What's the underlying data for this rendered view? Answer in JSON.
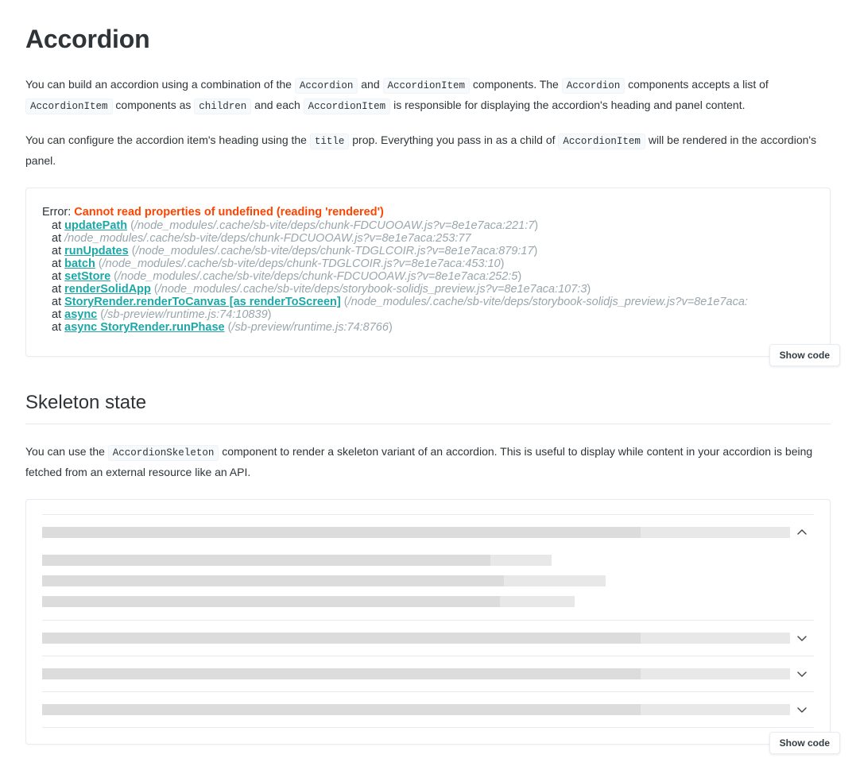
{
  "page": {
    "title": "Accordion"
  },
  "intro": {
    "p1": {
      "t1": "You can build an accordion using a combination of the ",
      "c1": "Accordion",
      "t2": " and ",
      "c2": "AccordionItem",
      "t3": " components. The ",
      "c3": "Accordion",
      "t4": " components accepts a list of ",
      "c4": "AccordionItem",
      "t5": " components as ",
      "c5": "children",
      "t6": " and each ",
      "c6": "AccordionItem",
      "t7": " is responsible for displaying the accordion's heading and panel content."
    },
    "p2": {
      "t1": "You can configure the accordion item's heading using the ",
      "c1": "title",
      "t2": " prop. Everything you pass in as a child of ",
      "c2": "AccordionItem",
      "t3": " will be rendered in the accordion's panel."
    }
  },
  "error_preview": {
    "label": "Error:",
    "message": "Cannot read properties of undefined (reading 'rendered')",
    "stack": [
      {
        "at": "at ",
        "fn": "updatePath",
        "open": " (",
        "loc": "/node_modules/.cache/sb-vite/deps/chunk-FDCUOOAW.js?v=8e1e7aca:221:7",
        "close": ")"
      },
      {
        "at": "at ",
        "fn": "",
        "open": "",
        "loc": "/node_modules/.cache/sb-vite/deps/chunk-FDCUOOAW.js?v=8e1e7aca:253:77",
        "close": ""
      },
      {
        "at": "at ",
        "fn": "runUpdates",
        "open": " (",
        "loc": "/node_modules/.cache/sb-vite/deps/chunk-TDGLCOIR.js?v=8e1e7aca:879:17",
        "close": ")"
      },
      {
        "at": "at ",
        "fn": "batch",
        "open": " (",
        "loc": "/node_modules/.cache/sb-vite/deps/chunk-TDGLCOIR.js?v=8e1e7aca:453:10",
        "close": ")"
      },
      {
        "at": "at ",
        "fn": "setStore",
        "open": " (",
        "loc": "/node_modules/.cache/sb-vite/deps/chunk-FDCUOOAW.js?v=8e1e7aca:252:5",
        "close": ")"
      },
      {
        "at": "at ",
        "fn": "renderSolidApp",
        "open": " (",
        "loc": "/node_modules/.cache/sb-vite/deps/storybook-solidjs_preview.js?v=8e1e7aca:107:3",
        "close": ")"
      },
      {
        "at": "at ",
        "fn": "StoryRender.renderToCanvas [as renderToScreen]",
        "open": " (",
        "loc": "/node_modules/.cache/sb-vite/deps/storybook-solidjs_preview.js?v=8e1e7aca:",
        "close": ""
      },
      {
        "at": "at ",
        "fn": "async",
        "open": " (",
        "loc": "/sb-preview/runtime.js:74:10839",
        "close": ")"
      },
      {
        "at": "at ",
        "fn": "async StoryRender.runPhase",
        "open": " (",
        "loc": "/sb-preview/runtime.js:74:8766",
        "close": ")"
      }
    ],
    "show_code_label": "Show code"
  },
  "skeleton_section": {
    "title": "Skeleton state",
    "p1": {
      "t1": "You can use the ",
      "c1": "AccordionSkeleton",
      "t2": " component to render a skeleton variant of an accordion. This is useful to display while content in your accordion is being fetched from an external resource like an API."
    },
    "show_code_label": "Show code",
    "items": [
      {
        "expanded": true,
        "chevron": "chevron-up-icon",
        "header": {
          "dark_pct": 80,
          "light_pct": 20,
          "width_pct": 100
        },
        "panel_rows": [
          {
            "dark_pct": 88,
            "light_pct": 12,
            "width_pct": 66
          },
          {
            "dark_pct": 82,
            "light_pct": 18,
            "width_pct": 73
          },
          {
            "dark_pct": 86,
            "light_pct": 14,
            "width_pct": 69
          }
        ]
      },
      {
        "expanded": false,
        "chevron": "chevron-down-icon",
        "header": {
          "dark_pct": 80,
          "light_pct": 20,
          "width_pct": 100
        },
        "panel_rows": []
      },
      {
        "expanded": false,
        "chevron": "chevron-down-icon",
        "header": {
          "dark_pct": 80,
          "light_pct": 20,
          "width_pct": 100
        },
        "panel_rows": []
      },
      {
        "expanded": false,
        "chevron": "chevron-down-icon",
        "header": {
          "dark_pct": 80,
          "light_pct": 20,
          "width_pct": 100
        },
        "panel_rows": []
      }
    ]
  },
  "colors": {
    "error_text": "#ff4400",
    "link": "#1ea7a7",
    "skeleton_dark": "#dcdcdc",
    "skeleton_light": "#e8e8e8",
    "border": "#e6ecf1",
    "code_bg": "#f7fafc"
  }
}
